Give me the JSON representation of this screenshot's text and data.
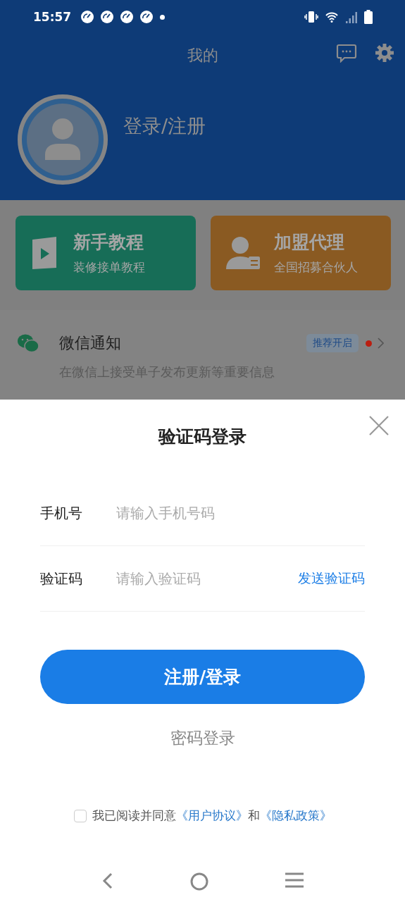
{
  "status_bar": {
    "time": "15:57"
  },
  "header": {
    "title": "我的",
    "login_text": "登录/注册"
  },
  "cards": [
    {
      "kind": "video",
      "title": "新手教程",
      "subtitle": "装修接单教程",
      "color": "#176d57"
    },
    {
      "kind": "agent",
      "title": "加盟代理",
      "subtitle": "全国招募合伙人",
      "color": "#8a5a22"
    }
  ],
  "notice": {
    "title": "微信通知",
    "badge": "推荐开启",
    "description": "在微信上接受单子发布更新等重要信息",
    "unread": true
  },
  "sheet": {
    "title": "验证码登录",
    "fields": [
      {
        "label": "手机号",
        "placeholder": "请输入手机号码"
      },
      {
        "label": "验证码",
        "placeholder": "请输入验证码",
        "action": "发送验证码"
      }
    ],
    "submit": "注册/登录",
    "alt_login": "密码登录",
    "agreement": {
      "checked": false,
      "parts": [
        {
          "kind": "text",
          "text": "我已阅读并同意"
        },
        {
          "kind": "link",
          "text": "《用户协议》"
        },
        {
          "kind": "text",
          "text": "和"
        },
        {
          "kind": "link",
          "text": "《隐私政策》"
        }
      ]
    }
  }
}
